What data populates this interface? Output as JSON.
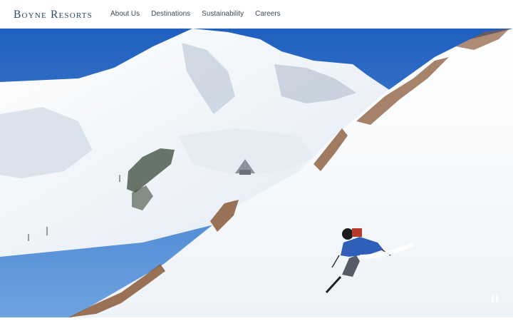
{
  "brand": {
    "logo_text": "Boyne Resorts"
  },
  "nav": {
    "items": [
      {
        "label": "About Us"
      },
      {
        "label": "Destinations"
      },
      {
        "label": "Sustainability"
      },
      {
        "label": "Careers"
      }
    ]
  },
  "hero": {
    "image": "skier-descending-snowy-mountain-slope",
    "pause_icon": "pause-icon"
  },
  "colors": {
    "logo": "#2a4a66",
    "nav_text": "#3b4a55",
    "sky": "#2e6fc4",
    "skier_jacket": "#2f5fb8"
  }
}
